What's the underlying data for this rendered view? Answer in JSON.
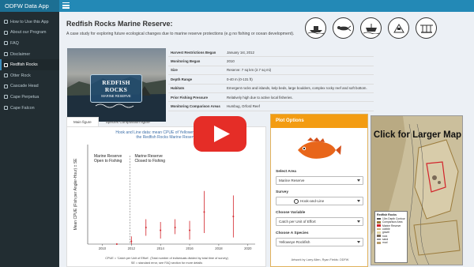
{
  "app": {
    "brand": "ODFW Data App"
  },
  "sidebar": {
    "items": [
      {
        "label": "How to Use this App"
      },
      {
        "label": "About our Program"
      },
      {
        "label": "FAQ"
      },
      {
        "label": "Disclaimer"
      },
      {
        "label": "Redfish Rocks"
      },
      {
        "label": "Otter Rock"
      },
      {
        "label": "Cascade Head"
      },
      {
        "label": "Cape Perpetua"
      },
      {
        "label": "Cape Falcon"
      }
    ],
    "active_index": 4
  },
  "page": {
    "title": "Redfish Rocks Marine Reserve:",
    "subtitle": "A case study for exploring future ecological changes due to marine reserve protections (e.g no fishing or ocean development)."
  },
  "photo": {
    "logo_title": "REDFISH ROCKS",
    "logo_sub": "MARINE RESERVE"
  },
  "info": [
    {
      "key": "Harvest Restrictions Began",
      "value": "January 1st, 2012"
    },
    {
      "key": "Monitoring Began",
      "value": "2010"
    },
    {
      "key": "Size",
      "value": "Reserve: 7 sq km (2.7 sq mi)"
    },
    {
      "key": "Depth Range",
      "value": "0-40 m (0-131 ft)"
    },
    {
      "key": "Habitats",
      "value": "Emergent rocks and islands, kelp beds, large boulders, complex rocky reef and soft bottom."
    },
    {
      "key": "Prior Fishing Pressure",
      "value": "Relatively high due to active local fisheries."
    },
    {
      "key": "Monitoring Comparison Areas",
      "value": "Humbug, Orford Reef"
    }
  ],
  "tabs": [
    {
      "label": "Main figure"
    },
    {
      "label": "Species Composition figure"
    }
  ],
  "chart_data": {
    "type": "scatter",
    "title": "Hook and Line data: mean CPUE of Yelloweye Rockfish at the Redfish Rocks Marine Reserve",
    "ylabel": "Mean CPUE (Fish per Angler-Hour) ± SE",
    "xlabel": "",
    "x_ticks": [
      "2010",
      "2012",
      "2014",
      "2016",
      "2018",
      "2020"
    ],
    "xlim": [
      2009,
      2020.5
    ],
    "ylim": [
      0,
      0.18
    ],
    "annotations": [
      "Marine Reserve Open to Fishing",
      "Marine Reserve Closed to Fishing"
    ],
    "divider_x": 2011.9,
    "points": [
      {
        "x": 2011,
        "y": 0.0,
        "lo": 0.0,
        "hi": 0.0
      },
      {
        "x": 2012,
        "y": 0.005,
        "lo": 0.0,
        "hi": 0.014
      },
      {
        "x": 2013,
        "y": 0.03,
        "lo": 0.015,
        "hi": 0.045
      },
      {
        "x": 2014,
        "y": 0.025,
        "lo": 0.01,
        "hi": 0.04
      },
      {
        "x": 2015,
        "y": 0.03,
        "lo": 0.018,
        "hi": 0.045
      },
      {
        "x": 2016,
        "y": 0.025,
        "lo": 0.008,
        "hi": 0.042
      },
      {
        "x": 2017,
        "y": 0.058,
        "lo": 0.02,
        "hi": 0.096
      },
      {
        "x": 2019,
        "y": 0.05,
        "lo": 0.012,
        "hi": 0.088
      }
    ],
    "caption_1": "CPUE = 'Catch per Unit of Effort'. (Total number of individuals divided by total time of survey)",
    "caption_2": "SE = standard error, see FAQ section for more details"
  },
  "controls": {
    "header": "Plot Options",
    "area_label": "Select Area",
    "area_value": "Marine Reserve",
    "survey_label": "Survey",
    "survey_value": "Hook-and-Line",
    "variable_label": "Choose Variable",
    "variable_value": "Catch per Unit of Effort",
    "species_label": "Choose A Species",
    "species_value": "Yelloweye Rockfish",
    "artwork": "Artwork by Larry Allen, Ryan Fields: ODFW"
  },
  "map": {
    "cta": "Click for Larger Map",
    "legend_title": "Redfish Rocks",
    "legend": [
      {
        "label": "10m Depth Contour",
        "color": "#555555"
      },
      {
        "label": "Comparison Area",
        "color": "#9b7b3c"
      },
      {
        "label": "Marine Reserve",
        "color": "#d2232a"
      },
      {
        "label": "cobble",
        "color": "#c9b27c"
      },
      {
        "label": "gravel",
        "color": "#e2d6a6"
      },
      {
        "label": "rock",
        "color": "#7a6a58"
      },
      {
        "label": "sand",
        "color": "#efe7c8"
      },
      {
        "label": "mud",
        "color": "#b89c6a"
      }
    ]
  }
}
